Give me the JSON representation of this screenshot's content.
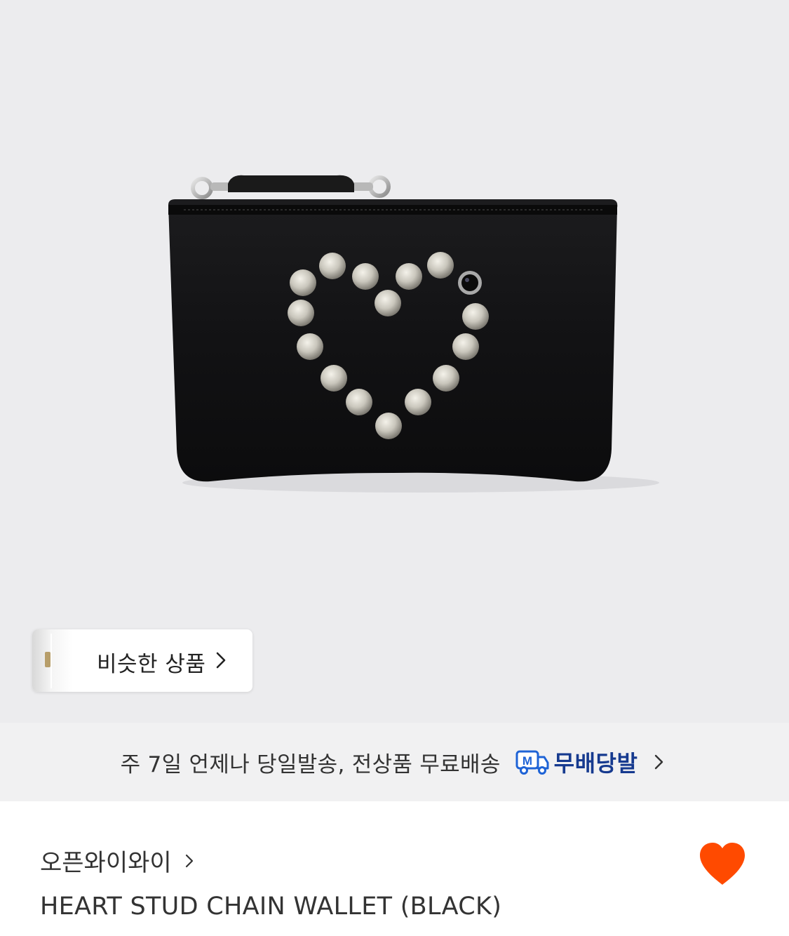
{
  "hero": {
    "image_alt": "HEART STUD CHAIN WALLET (BLACK)"
  },
  "similar": {
    "label": "비슷한 상품"
  },
  "shipping": {
    "text": "주 7일 언제나 당일발송, 전상품 무료배송",
    "badge_icon": "M",
    "badge_label": "무배당발"
  },
  "product": {
    "brand": "오픈와이와이",
    "title": "HEART STUD CHAIN WALLET (BLACK)",
    "liked": true
  },
  "colors": {
    "hero_bg": "#ececee",
    "badge_blue": "#163a8f",
    "heart_orange": "#ff4a00"
  }
}
